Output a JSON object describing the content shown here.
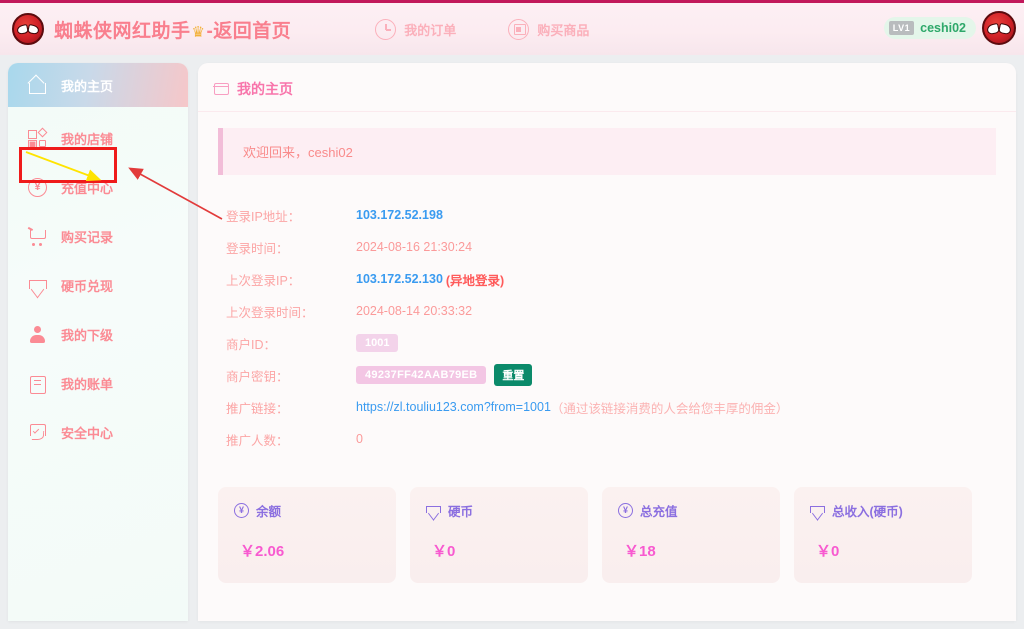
{
  "header": {
    "logo_icon": "spiderman-mask-icon",
    "brand_title": "蜘蛛侠网红助手",
    "crown": "♛",
    "brand_suffix": "-返回首页",
    "nav": [
      {
        "label": "我的订单",
        "icon": "clock-history-icon"
      },
      {
        "label": "购买商品",
        "icon": "shop-bag-icon"
      }
    ],
    "user": {
      "level_badge": "LV1",
      "name": "ceshi02",
      "avatar_icon": "spiderman-avatar-icon"
    }
  },
  "sidebar": {
    "items": [
      {
        "label": "我的主页",
        "icon": "home-icon",
        "active": true
      },
      {
        "label": "我的店铺",
        "icon": "shop-grid-icon",
        "active": false
      },
      {
        "label": "充值中心",
        "icon": "yen-circle-icon",
        "active": false,
        "highlighted": true
      },
      {
        "label": "购买记录",
        "icon": "cart-icon",
        "active": false
      },
      {
        "label": "硬币兑现",
        "icon": "diamond-icon",
        "active": false
      },
      {
        "label": "我的下级",
        "icon": "person-icon",
        "active": false
      },
      {
        "label": "我的账单",
        "icon": "clipboard-icon",
        "active": false
      },
      {
        "label": "安全中心",
        "icon": "shield-check-icon",
        "active": false
      }
    ]
  },
  "panel": {
    "icon": "window-icon",
    "title": "我的主页",
    "welcome": "欢迎回来，ceshi02"
  },
  "info": {
    "rows": [
      {
        "label": "登录IP地址：",
        "value": "103.172.52.198",
        "style": "blue"
      },
      {
        "label": "登录时间：",
        "value": "2024-08-16 21:30:24",
        "style": "pink"
      },
      {
        "label": "上次登录IP：",
        "value": "103.172.52.130",
        "style": "blue",
        "warning": "(异地登录)"
      },
      {
        "label": "上次登录时间：",
        "value": "2024-08-14 20:33:32",
        "style": "pink"
      },
      {
        "label": "商户ID：",
        "value": "1001",
        "style": "tag-id"
      },
      {
        "label": "商户密钥：",
        "value": "49237FF42AAB79EB",
        "style": "tag-key",
        "button": "重置"
      },
      {
        "label": "推广链接：",
        "value": "https://zl.touliu123.com?from=1001",
        "style": "link",
        "note": "（通过该链接消费的人会给您丰厚的佣金）"
      },
      {
        "label": "推广人数：",
        "value": "0",
        "style": "pink"
      }
    ]
  },
  "cards": [
    {
      "label": "余额",
      "icon": "yen-circle-icon",
      "value": "￥2.06"
    },
    {
      "label": "硬币",
      "icon": "diamond-icon",
      "value": "￥0"
    },
    {
      "label": "总充值",
      "icon": "yen-circle-icon",
      "value": "￥18"
    },
    {
      "label": "总收入(硬币)",
      "icon": "diamond-icon",
      "value": "￥0"
    }
  ],
  "annotations": {
    "highlight_box_color": "#ef1b1b",
    "arrow_color": "#e23b3b",
    "inner_arrow_color": "#ffe400"
  }
}
